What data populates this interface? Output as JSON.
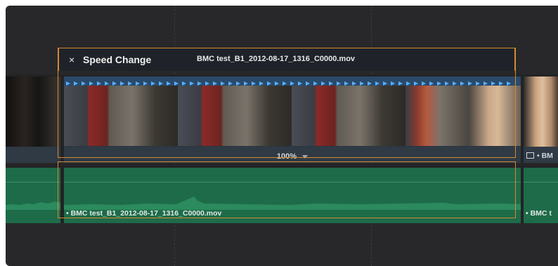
{
  "speed_change": {
    "close_label": "×",
    "title": "Speed Change",
    "clip_name": "BMC test_B1_2012-08-17_1316_C0000.mov",
    "speed_value": "100%"
  },
  "audio_clip": {
    "label": "• BMC test_B1_2012-08-17_1316_C0000.mov"
  },
  "next_video_clip": {
    "label": "• BM"
  },
  "next_audio_clip": {
    "label": "• BMC t"
  },
  "colors": {
    "selection_border": "#d48a30",
    "speed_arrows": "#5ab0ff",
    "audio_clip": "#1e6b49",
    "video_clip": "#2a3540"
  },
  "icons": [
    "close-icon",
    "dropdown-caret-icon",
    "clapper-icon",
    "speed-arrow-icon"
  ]
}
